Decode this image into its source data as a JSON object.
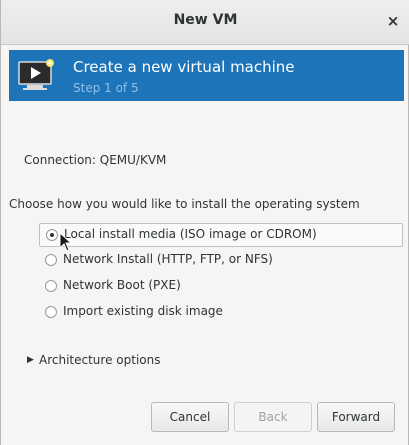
{
  "window": {
    "title": "New VM",
    "close_glyph": "×"
  },
  "banner": {
    "title": "Create a new virtual machine",
    "step": "Step 1 of 5",
    "icon": "virtual-machine-icon",
    "bg_color": "#1e74b8"
  },
  "connection": {
    "label": "Connection: QEMU/KVM"
  },
  "install": {
    "prompt": "Choose how you would like to install the operating system",
    "options": [
      {
        "label": "Local install media (ISO image or CDROM)",
        "selected": true
      },
      {
        "label": "Network Install (HTTP, FTP, or NFS)",
        "selected": false
      },
      {
        "label": "Network Boot (PXE)",
        "selected": false
      },
      {
        "label": "Import existing disk image",
        "selected": false
      }
    ]
  },
  "architecture": {
    "label": "Architecture options",
    "expanded": false
  },
  "buttons": {
    "cancel": "Cancel",
    "back": "Back",
    "forward": "Forward"
  }
}
